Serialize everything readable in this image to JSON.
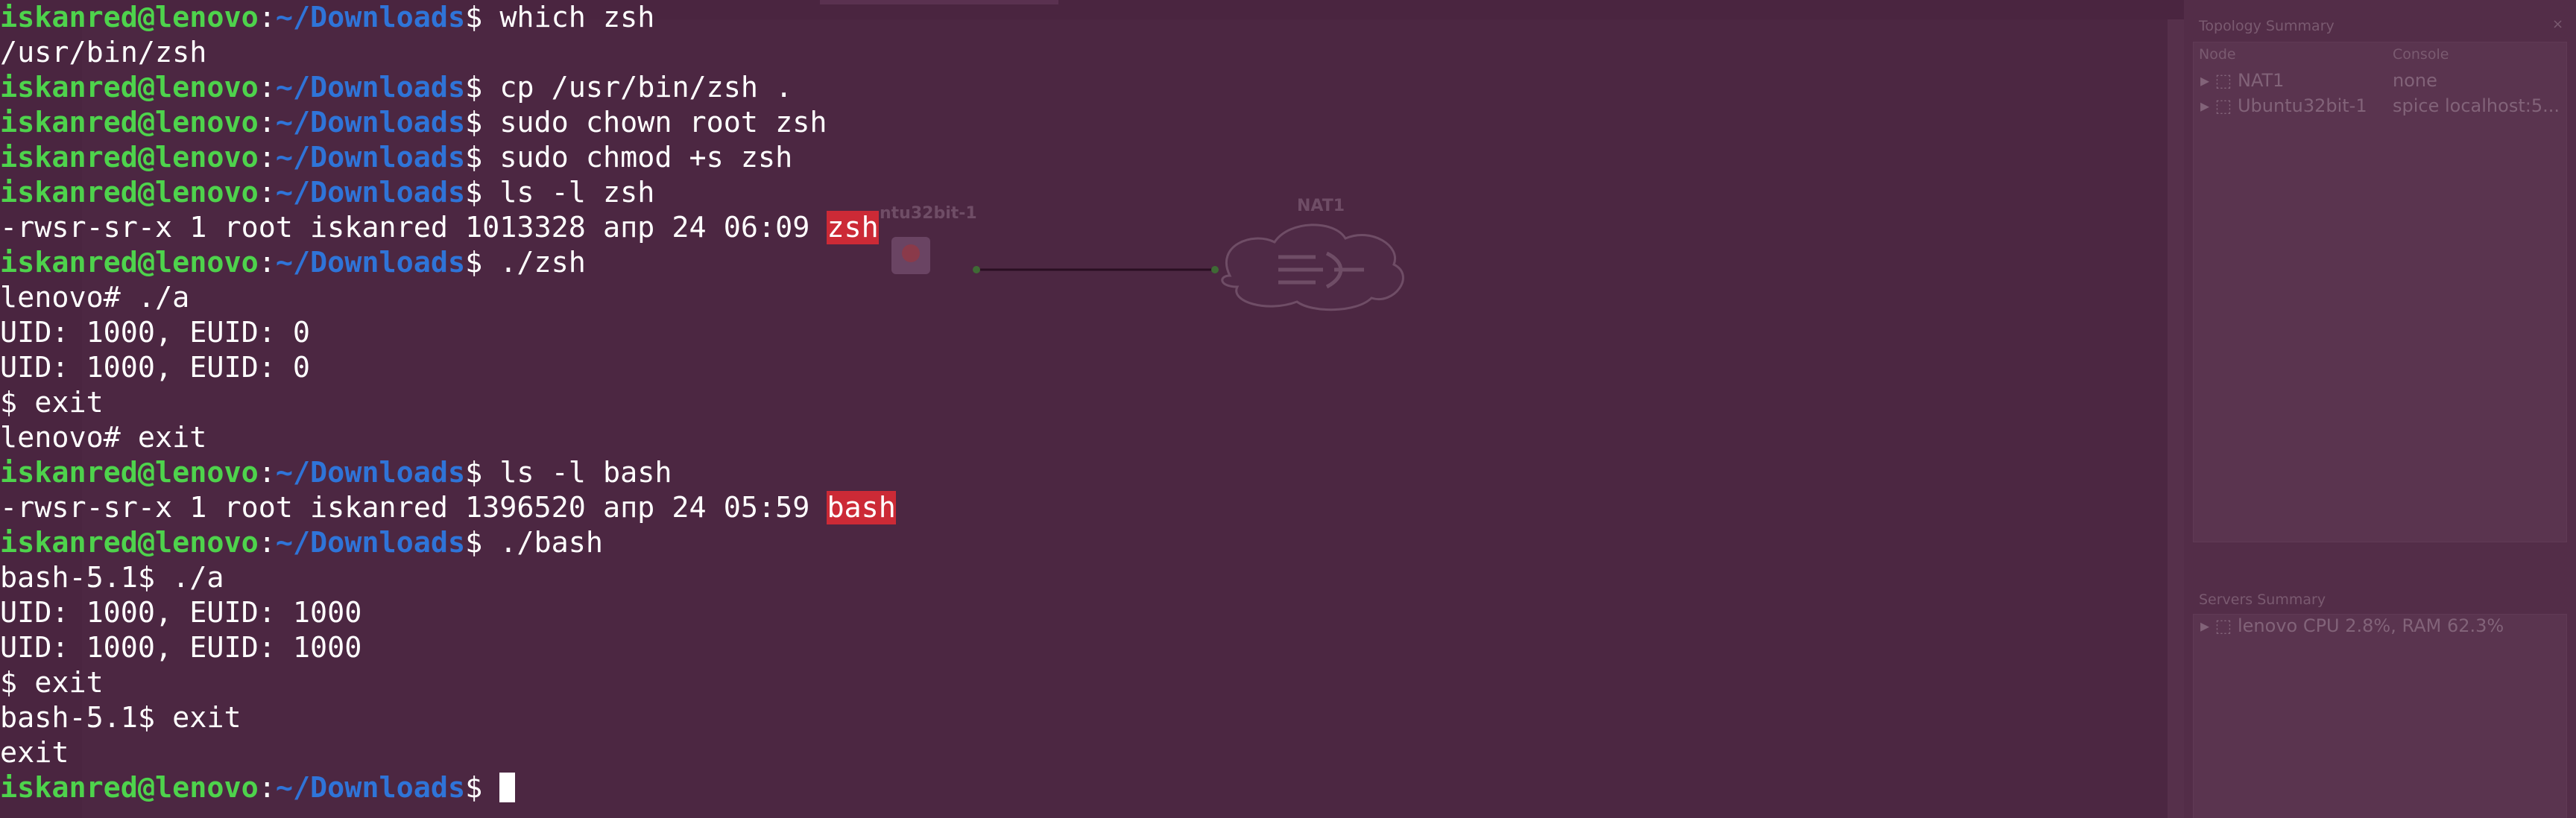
{
  "prompt": {
    "user": "iskanred@lenovo",
    "colon": ":",
    "path": "~/Downloads",
    "dollar": "$ "
  },
  "terminal": {
    "lines": [
      {
        "type": "prompt",
        "cmd": "which zsh"
      },
      {
        "type": "out",
        "text": "/usr/bin/zsh"
      },
      {
        "type": "prompt",
        "cmd": "cp /usr/bin/zsh ."
      },
      {
        "type": "prompt",
        "cmd": "sudo chown root zsh"
      },
      {
        "type": "prompt",
        "cmd": "sudo chmod +s zsh"
      },
      {
        "type": "prompt",
        "cmd": "ls -l zsh"
      },
      {
        "type": "ls",
        "text": "-rwsr-sr-x 1 root iskanred 1013328 апр 24 06:09 ",
        "file": "zsh"
      },
      {
        "type": "prompt",
        "cmd": "./zsh"
      },
      {
        "type": "out",
        "text": "lenovo# ./a"
      },
      {
        "type": "out",
        "text": "UID: 1000, EUID: 0"
      },
      {
        "type": "out",
        "text": "UID: 1000, EUID: 0"
      },
      {
        "type": "out",
        "text": "$ exit"
      },
      {
        "type": "out",
        "text": "lenovo# exit"
      },
      {
        "type": "prompt",
        "cmd": "ls -l bash"
      },
      {
        "type": "ls",
        "text": "-rwsr-sr-x 1 root iskanred 1396520 апр 24 05:59 ",
        "file": "bash"
      },
      {
        "type": "prompt",
        "cmd": "./bash"
      },
      {
        "type": "out",
        "text": "bash-5.1$ ./a"
      },
      {
        "type": "out",
        "text": "UID: 1000, EUID: 1000"
      },
      {
        "type": "out",
        "text": "UID: 1000, EUID: 1000"
      },
      {
        "type": "out",
        "text": "$ exit"
      },
      {
        "type": "out",
        "text": "bash-5.1$ exit"
      },
      {
        "type": "out",
        "text": "exit"
      },
      {
        "type": "prompt",
        "cmd": "",
        "cursor": true
      }
    ]
  },
  "gns3": {
    "topology_summary": {
      "title": "Topology Summary",
      "col_node": "Node",
      "col_console": "Console",
      "rows": [
        {
          "node": "NAT1",
          "console": "none"
        },
        {
          "node": "Ubuntu32bit-1",
          "console": "spice localhost:5..."
        }
      ]
    },
    "servers_summary": {
      "title": "Servers Summary",
      "rows": [
        {
          "text": "lenovo CPU 2.8%, RAM 62.3%"
        }
      ]
    },
    "nodes": {
      "ubuntu_label": "ntu32bit-1",
      "nat_label": "NAT1"
    }
  },
  "colors": {
    "prompt_user": "#4ed34c",
    "prompt_path": "#2f74d8",
    "exe_highlight": "#cc2a36",
    "terminal_bg": "#3b1b31"
  }
}
